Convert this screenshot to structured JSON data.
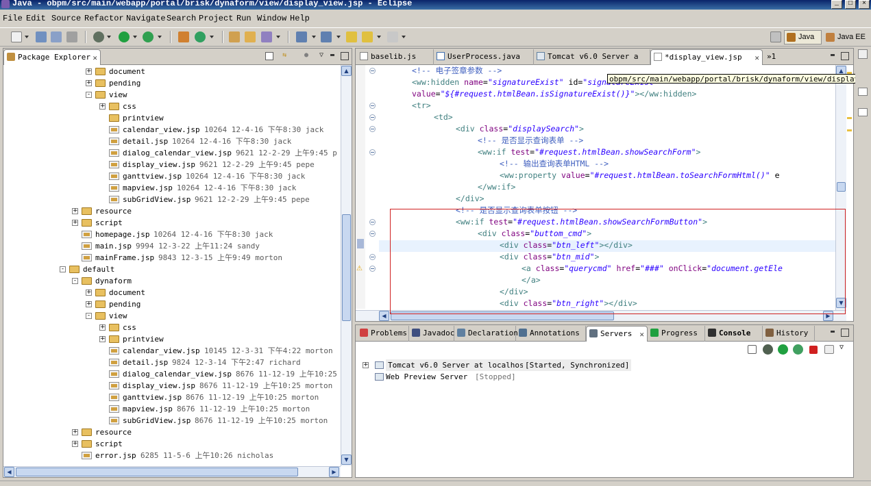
{
  "window": {
    "title": "Java - obpm/src/main/webapp/portal/brisk/dynaform/view/display_view.jsp - Eclipse",
    "min": "_",
    "max": "□",
    "close": "×"
  },
  "menu": [
    "File",
    "Edit",
    "Source",
    "Refactor",
    "Navigate",
    "Search",
    "Project",
    "Run",
    "Window",
    "Help"
  ],
  "perspectives": [
    {
      "label": "Java",
      "icon": "java-perspective-icon"
    },
    {
      "label": "Java EE",
      "icon": "javaee-perspective-icon"
    }
  ],
  "package_explorer": {
    "title": "Package Explorer",
    "tree": [
      {
        "depth": 2,
        "expander": "+",
        "type": "folder",
        "label": "document",
        "info": ""
      },
      {
        "depth": 2,
        "expander": "+",
        "type": "folder",
        "label": "pending",
        "info": ""
      },
      {
        "depth": 2,
        "expander": "-",
        "type": "folder",
        "label": "view",
        "info": ""
      },
      {
        "depth": 3,
        "expander": "+",
        "type": "folder",
        "label": "css",
        "info": ""
      },
      {
        "depth": 3,
        "expander": "",
        "type": "folder",
        "label": "printview",
        "info": ""
      },
      {
        "depth": 3,
        "expander": "",
        "type": "file",
        "label": "calendar_view.jsp",
        "info": "10264  12-4-16 下午8:30  jack"
      },
      {
        "depth": 3,
        "expander": "",
        "type": "file",
        "label": "detail.jsp",
        "info": "10264  12-4-16 下午8:30  jack"
      },
      {
        "depth": 3,
        "expander": "",
        "type": "file",
        "label": "dialog_calendar_view.jsp",
        "info": "9621  12-2-29 上午9:45  p"
      },
      {
        "depth": 3,
        "expander": "",
        "type": "file",
        "label": "display_view.jsp",
        "info": "9621  12-2-29 上午9:45  pepe"
      },
      {
        "depth": 3,
        "expander": "",
        "type": "file",
        "label": "ganttview.jsp",
        "info": "10264  12-4-16 下午8:30  jack"
      },
      {
        "depth": 3,
        "expander": "",
        "type": "file",
        "label": "mapview.jsp",
        "info": "10264  12-4-16 下午8:30  jack"
      },
      {
        "depth": 3,
        "expander": "",
        "type": "file",
        "label": "subGridView.jsp",
        "info": "9621  12-2-29 上午9:45  pepe"
      },
      {
        "depth": 1,
        "expander": "+",
        "type": "folder",
        "label": "resource",
        "info": ""
      },
      {
        "depth": 1,
        "expander": "+",
        "type": "folder",
        "label": "script",
        "info": ""
      },
      {
        "depth": 1,
        "expander": "",
        "type": "file",
        "label": "homepage.jsp",
        "info": "10264  12-4-16 下午8:30  jack"
      },
      {
        "depth": 1,
        "expander": "",
        "type": "file",
        "label": "main.jsp",
        "info": "9994  12-3-22 上午11:24  sandy"
      },
      {
        "depth": 1,
        "expander": "",
        "type": "file",
        "label": "mainFrame.jsp",
        "info": "9843  12-3-15 上午9:49  morton"
      },
      {
        "depth": 0,
        "expander": "-",
        "type": "folder",
        "label": "default",
        "info": ""
      },
      {
        "depth": 1,
        "expander": "-",
        "type": "folder",
        "label": "dynaform",
        "info": ""
      },
      {
        "depth": 2,
        "expander": "+",
        "type": "folder",
        "label": "document",
        "info": ""
      },
      {
        "depth": 2,
        "expander": "+",
        "type": "folder",
        "label": "pending",
        "info": ""
      },
      {
        "depth": 2,
        "expander": "-",
        "type": "folder",
        "label": "view",
        "info": ""
      },
      {
        "depth": 3,
        "expander": "+",
        "type": "folder",
        "label": "css",
        "info": ""
      },
      {
        "depth": 3,
        "expander": "+",
        "type": "folder",
        "label": "printview",
        "info": ""
      },
      {
        "depth": 3,
        "expander": "",
        "type": "file",
        "label": "calendar_view.jsp",
        "info": "10145  12-3-31 下午4:22  morton"
      },
      {
        "depth": 3,
        "expander": "",
        "type": "file",
        "label": "detail.jsp",
        "info": "9824  12-3-14 下午2:47  richard"
      },
      {
        "depth": 3,
        "expander": "",
        "type": "file",
        "label": "dialog_calendar_view.jsp",
        "info": "8676  11-12-19 上午10:25"
      },
      {
        "depth": 3,
        "expander": "",
        "type": "file",
        "label": "display_view.jsp",
        "info": "8676  11-12-19 上午10:25  morton"
      },
      {
        "depth": 3,
        "expander": "",
        "type": "file",
        "label": "ganttview.jsp",
        "info": "8676  11-12-19 上午10:25  morton"
      },
      {
        "depth": 3,
        "expander": "",
        "type": "file",
        "label": "mapview.jsp",
        "info": "8676  11-12-19 上午10:25  morton"
      },
      {
        "depth": 3,
        "expander": "",
        "type": "file",
        "label": "subGridView.jsp",
        "info": "8676  11-12-19 上午10:25  morton"
      },
      {
        "depth": 1,
        "expander": "+",
        "type": "folder",
        "label": "resource",
        "info": ""
      },
      {
        "depth": 1,
        "expander": "+",
        "type": "folder",
        "label": "script",
        "info": ""
      },
      {
        "depth": 1,
        "expander": "",
        "type": "file",
        "label": "error.jsp",
        "info": "6285  11-5-6 上午10:26  nicholas"
      }
    ]
  },
  "editor": {
    "tabs": [
      {
        "label": "baselib.js",
        "active": false,
        "closable": false
      },
      {
        "label": "UserProcess.java",
        "active": false,
        "closable": false
      },
      {
        "label": "Tomcat v6.0 Server a",
        "active": false,
        "closable": false
      },
      {
        "label": "*display_view.jsp",
        "active": true,
        "closable": true
      }
    ],
    "tab_overflow": "»1",
    "tooltip": "obpm/src/main/webapp/portal/brisk/dynaform/view/display_view.jsp",
    "lines": [
      [
        {
          "c": "cmt",
          "t": "<!-- 电子签章参数 -->"
        }
      ],
      [
        {
          "c": "tag",
          "t": "<ww:hidden "
        },
        {
          "c": "attr",
          "t": "name"
        },
        {
          "c": "txt",
          "t": "="
        },
        {
          "c": "val",
          "t": "\"signatureExist\""
        },
        {
          "c": "txt",
          "t": " id="
        },
        {
          "c": "val",
          "t": "\"signatureExist\""
        }
      ],
      [
        {
          "c": "attr",
          "t": "value"
        },
        {
          "c": "txt",
          "t": "="
        },
        {
          "c": "val",
          "t": "\"${#request.htmlBean.isSignatureExist()}\""
        },
        {
          "c": "tag",
          "t": "></ww:hidden>"
        }
      ],
      [
        {
          "c": "tag",
          "t": "<tr>"
        }
      ],
      [
        {
          "c": "tag",
          "t": "<td>"
        }
      ],
      [
        {
          "c": "tag",
          "t": "<div "
        },
        {
          "c": "attr",
          "t": "class"
        },
        {
          "c": "txt",
          "t": "="
        },
        {
          "c": "val",
          "t": "\"displaySearch\""
        },
        {
          "c": "tag",
          "t": ">"
        }
      ],
      [
        {
          "c": "cmt",
          "t": "<!-- 是否显示查询表单 -->"
        }
      ],
      [
        {
          "c": "tag",
          "t": "<ww:if "
        },
        {
          "c": "attr",
          "t": "test"
        },
        {
          "c": "txt",
          "t": "="
        },
        {
          "c": "val",
          "t": "\"#request.htmlBean.showSearchForm\""
        },
        {
          "c": "tag",
          "t": ">"
        }
      ],
      [
        {
          "c": "cmt",
          "t": "<!-- 输出查询表单HTML -->"
        }
      ],
      [
        {
          "c": "tag",
          "t": "<ww:property "
        },
        {
          "c": "attr",
          "t": "value"
        },
        {
          "c": "txt",
          "t": "="
        },
        {
          "c": "val",
          "t": "\"#request.htmlBean.toSearchFormHtml()\""
        },
        {
          "c": "txt",
          "t": " e"
        }
      ],
      [
        {
          "c": "tag",
          "t": "</ww:if>"
        }
      ],
      [
        {
          "c": "tag",
          "t": "</div>"
        }
      ],
      [
        {
          "c": "cmt",
          "t": "<!-- 是否显示查询表单按钮 -->"
        }
      ],
      [
        {
          "c": "tag",
          "t": "<ww:if "
        },
        {
          "c": "attr",
          "t": "test"
        },
        {
          "c": "txt",
          "t": "="
        },
        {
          "c": "val",
          "t": "\"#request.htmlBean.showSearchFormButton\""
        },
        {
          "c": "tag",
          "t": ">"
        }
      ],
      [
        {
          "c": "tag",
          "t": "<div "
        },
        {
          "c": "attr",
          "t": "class"
        },
        {
          "c": "txt",
          "t": "="
        },
        {
          "c": "val",
          "t": "\"buttom_cmd\""
        },
        {
          "c": "tag",
          "t": ">"
        }
      ],
      [
        {
          "c": "tag",
          "t": "<div "
        },
        {
          "c": "attr",
          "t": "class"
        },
        {
          "c": "txt",
          "t": "="
        },
        {
          "c": "val",
          "t": "\"btn_left\""
        },
        {
          "c": "tag",
          "t": "></div>"
        }
      ],
      [
        {
          "c": "tag",
          "t": "<div "
        },
        {
          "c": "attr",
          "t": "class"
        },
        {
          "c": "txt",
          "t": "="
        },
        {
          "c": "val",
          "t": "\"btn_mid\""
        },
        {
          "c": "tag",
          "t": ">"
        }
      ],
      [
        {
          "c": "tag",
          "t": "<a "
        },
        {
          "c": "attr",
          "t": "class"
        },
        {
          "c": "txt",
          "t": "="
        },
        {
          "c": "val",
          "t": "\"querycmd\""
        },
        {
          "c": "txt",
          "t": " "
        },
        {
          "c": "attr",
          "t": "href"
        },
        {
          "c": "txt",
          "t": "="
        },
        {
          "c": "val",
          "t": "\"###\""
        },
        {
          "c": "txt",
          "t": " "
        },
        {
          "c": "attr",
          "t": "onClick"
        },
        {
          "c": "txt",
          "t": "="
        },
        {
          "c": "val",
          "t": "\"document.getEle"
        }
      ],
      [
        {
          "c": "tag",
          "t": "</a>"
        }
      ],
      [
        {
          "c": "tag",
          "t": "</div>"
        }
      ],
      [
        {
          "c": "tag",
          "t": "<div "
        },
        {
          "c": "attr",
          "t": "class"
        },
        {
          "c": "txt",
          "t": "="
        },
        {
          "c": "val",
          "t": "\"btn_right\""
        },
        {
          "c": "tag",
          "t": "></div>"
        }
      ]
    ]
  },
  "bottom": {
    "tabs": [
      {
        "label": "Problems",
        "icon": "problems-icon",
        "active": false
      },
      {
        "label": "Javadoc",
        "icon": "javadoc-icon",
        "active": false
      },
      {
        "label": "Declaration",
        "icon": "declaration-icon",
        "active": false
      },
      {
        "label": "Annotations",
        "icon": "annotations-icon",
        "active": false
      },
      {
        "label": "Servers",
        "icon": "servers-icon",
        "active": true
      },
      {
        "label": "Progress",
        "icon": "progress-icon",
        "active": false
      },
      {
        "label": "Console",
        "icon": "console-icon",
        "active": false
      },
      {
        "label": "History",
        "icon": "history-icon",
        "active": false
      }
    ],
    "servers": [
      {
        "name": "Tomcat v6.0 Server at localhost",
        "state": "[Started, Synchronized]"
      },
      {
        "name": "Web Preview Server",
        "state": "[Stopped]"
      }
    ]
  },
  "colors": {
    "comment": "#3f5fbf",
    "tag": "#3f7f7f",
    "attribute": "#7f007f",
    "value": "#2a00ff",
    "highlight_box": "#d02020"
  }
}
